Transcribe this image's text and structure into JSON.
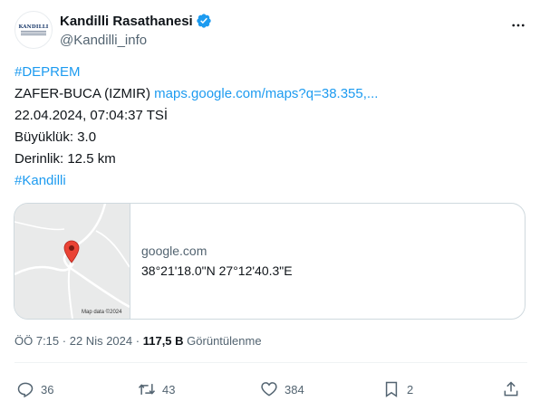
{
  "author": {
    "display_name": "Kandilli Rasathanesi",
    "handle": "@Kandilli_info",
    "avatar_text": "KANDILLI",
    "verified_icon": "verified-badge-icon",
    "more_icon": "more-options-icon"
  },
  "post": {
    "hashtag1": "#DEPREM",
    "location": "ZAFER-BUCA (IZMIR)",
    "map_link": "maps.google.com/maps?q=38.355,...",
    "datetime": "22.04.2024, 07:04:37 TSİ",
    "magnitude": "Büyüklük: 3.0",
    "depth": "Derinlik: 12.5 km",
    "hashtag2": "#Kandilli"
  },
  "card": {
    "domain": "google.com",
    "title": "38°21'18.0\"N 27°12'40.3\"E",
    "map_credit": "Map data ©2024",
    "pin_icon": "map-pin-icon"
  },
  "meta": {
    "time": "ÖÖ 7:15",
    "separator": "·",
    "date": "22 Nis 2024",
    "views_count": "117,5 B",
    "views_label": "Görüntülenme"
  },
  "actions": {
    "reply_count": "36",
    "repost_count": "43",
    "like_count": "384",
    "bookmark_count": "2",
    "icons": [
      "reply-icon",
      "repost-icon",
      "like-icon",
      "bookmark-icon",
      "share-icon"
    ]
  },
  "colors": {
    "accent": "#1d9bf0",
    "text": "#0f1419",
    "secondary": "#536471",
    "pin": "#ea4335"
  }
}
